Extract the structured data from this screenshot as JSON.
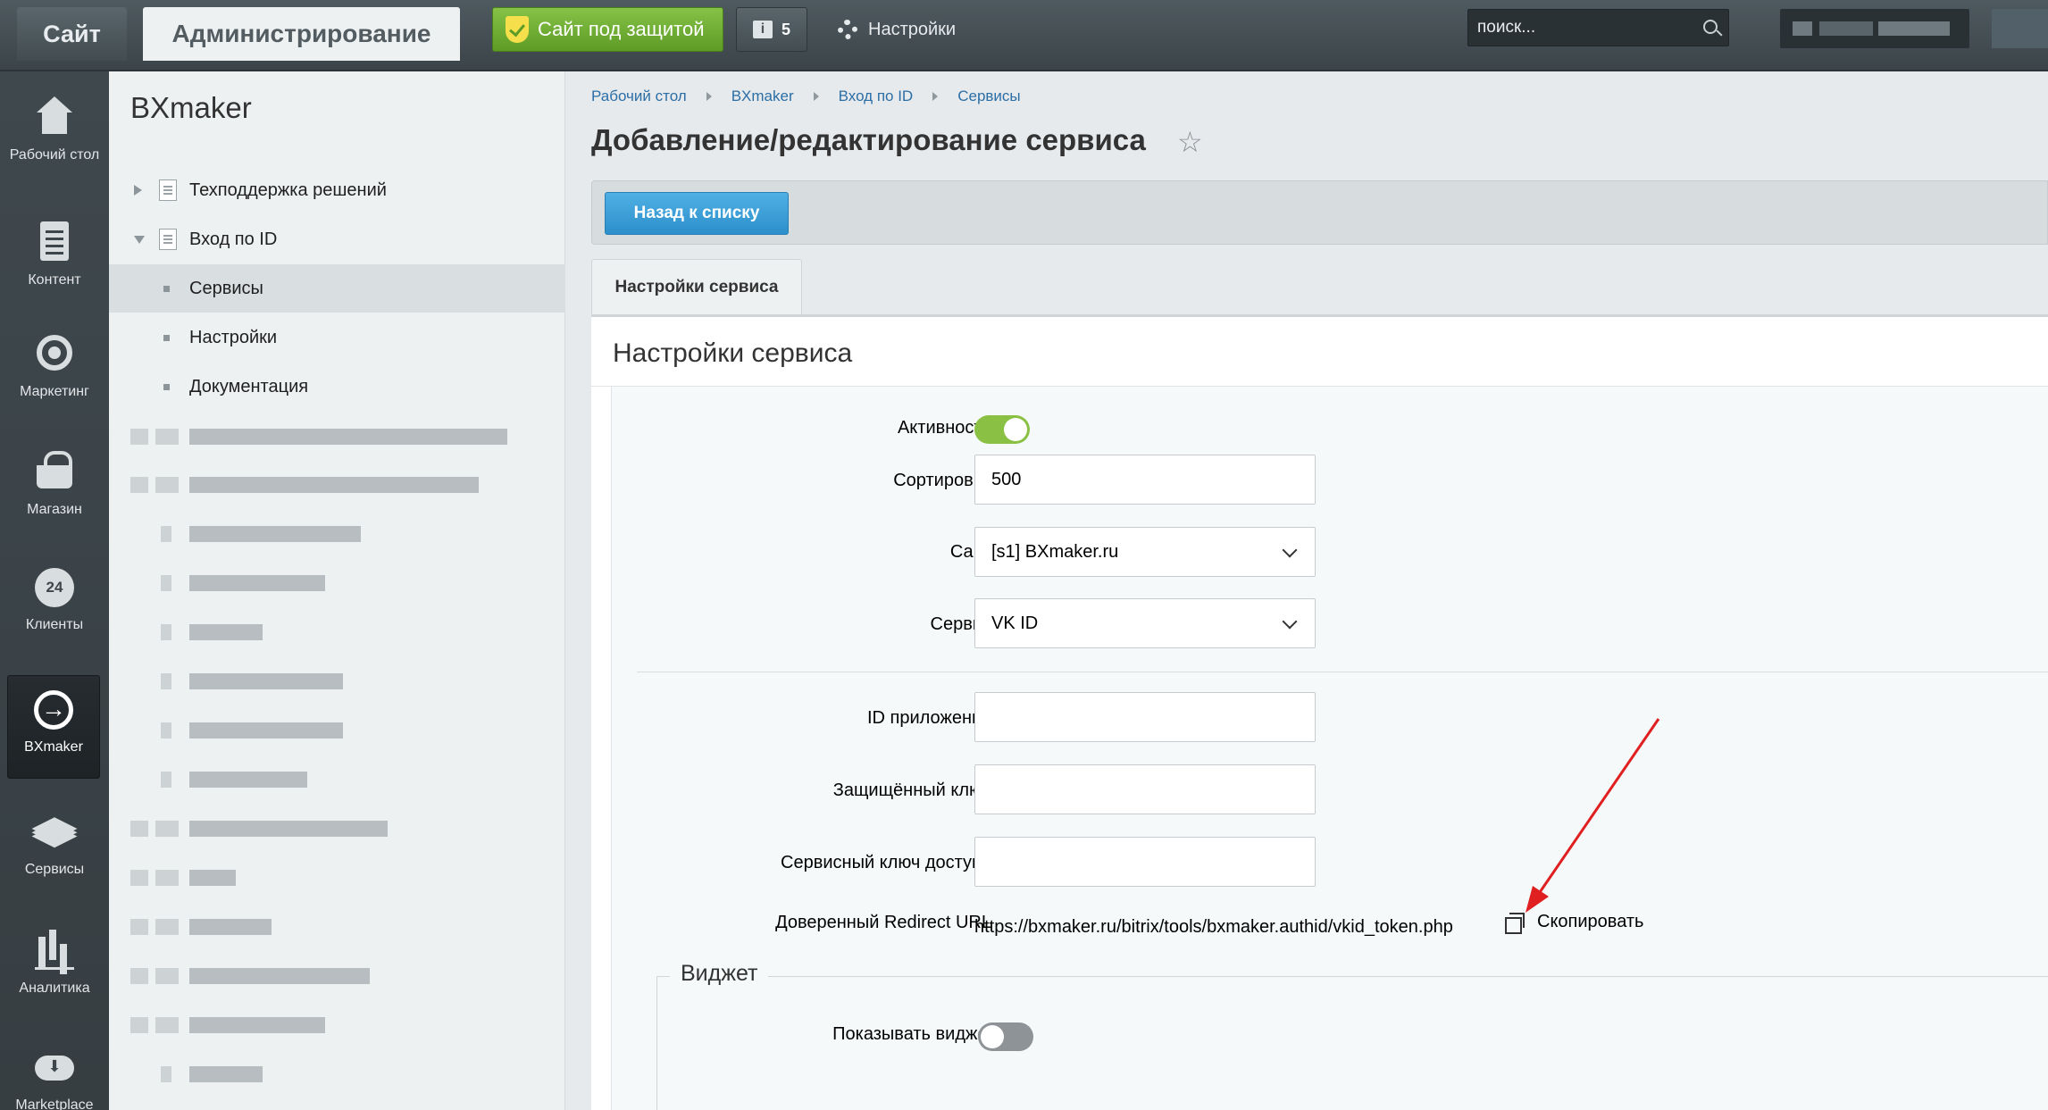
{
  "topbar": {
    "site_tab": "Сайт",
    "admin_tab": "Администрирование",
    "protected_label": "Сайт под защитой",
    "notify_count": "5",
    "notify_icon": "info-icon",
    "settings_label": "Настройки",
    "search_placeholder": "поиск..."
  },
  "leftmenu": [
    {
      "label": "Рабочий стол",
      "icon": "house-icon"
    },
    {
      "label": "Контент",
      "icon": "document-icon"
    },
    {
      "label": "Маркетинг",
      "icon": "target-icon"
    },
    {
      "label": "Магазин",
      "icon": "basket-icon"
    },
    {
      "label": "Клиенты",
      "icon": "clients-24-icon",
      "badge": "24"
    },
    {
      "label": "BXmaker",
      "icon": "arrow-circle-icon",
      "active": true
    },
    {
      "label": "Сервисы",
      "icon": "layers-icon"
    },
    {
      "label": "Аналитика",
      "icon": "bars-icon"
    },
    {
      "label": "Marketplace",
      "icon": "cloud-download-icon"
    }
  ],
  "sidebar": {
    "title": "BXmaker",
    "items": [
      {
        "label": "Техподдержка решений",
        "expanded": false
      },
      {
        "label": "Вход по ID",
        "expanded": true
      },
      {
        "label": "Сервисы",
        "selected": true
      },
      {
        "label": "Настройки"
      },
      {
        "label": "Документация"
      }
    ]
  },
  "breadcrumb": [
    "Рабочий стол",
    "BXmaker",
    "Вход по ID",
    "Сервисы"
  ],
  "page": {
    "title": "Добавление/редактирование сервиса",
    "back_label": "Назад к списку",
    "tab_label": "Настройки сервиса",
    "panel_title": "Настройки сервиса"
  },
  "form": {
    "active_label": "Активность",
    "active_value": true,
    "sort_label": "Сортировка",
    "sort_value": "500",
    "site_label": "Сайт",
    "site_value": "[s1] BXmaker.ru",
    "service_label": "Сервис",
    "service_value": "VK ID",
    "app_id_label": "ID приложения",
    "app_id_value": "",
    "secret_label": "Защищённый ключ",
    "secret_value": "",
    "service_key_label": "Сервисный ключ доступа",
    "service_key_value": "",
    "redirect_label": "Доверенный Redirect URL",
    "redirect_value": "https://bxmaker.ru/bitrix/tools/bxmaker.authid/vkid_token.php",
    "copy_label": "Скопировать",
    "widget_legend": "Виджет",
    "show_widget_label": "Показывать виджет",
    "show_widget_value": false
  },
  "colors": {
    "toggle_on": "#8ac144",
    "toggle_off": "#8d9396",
    "back_button": "#2d8fcb",
    "protected_button": "#5d9b26",
    "annotation_arrow": "#e02020"
  }
}
